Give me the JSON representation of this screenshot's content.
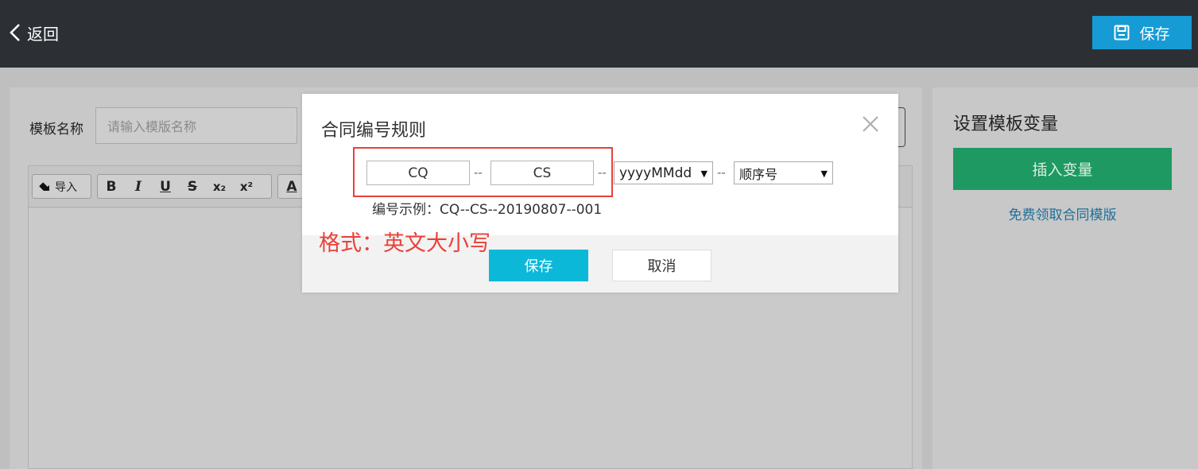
{
  "header": {
    "back_label": "返回",
    "save_label": "保存"
  },
  "form": {
    "name_label": "模板名称",
    "name_placeholder": "请输入模版名称"
  },
  "toolbar": {
    "import_label": "导入",
    "bold": "B",
    "italic": "I",
    "underline": "U",
    "strike": "S",
    "subscript": "x₂",
    "superscript": "x²",
    "font_color": "A"
  },
  "sidebar": {
    "title": "设置模板变量",
    "insert_label": "插入变量",
    "free_template_link": "免费领取合同模版"
  },
  "dialog": {
    "title": "合同编号规则",
    "prefix1": "CQ",
    "prefix2": "CS",
    "separator": "--",
    "date_format": "yyyyMMdd",
    "sequence": "顺序号",
    "example": "编号示例：CQ--CS--20190807--001",
    "annotation": "格式：英文大小写",
    "save_label": "保存",
    "cancel_label": "取消"
  },
  "colors": {
    "topbar": "#2c3034",
    "accent_blue": "#169bd5",
    "dialog_save": "#0bb8d8",
    "insert_green": "#1e9961",
    "annotation_red": "#e8413a"
  }
}
